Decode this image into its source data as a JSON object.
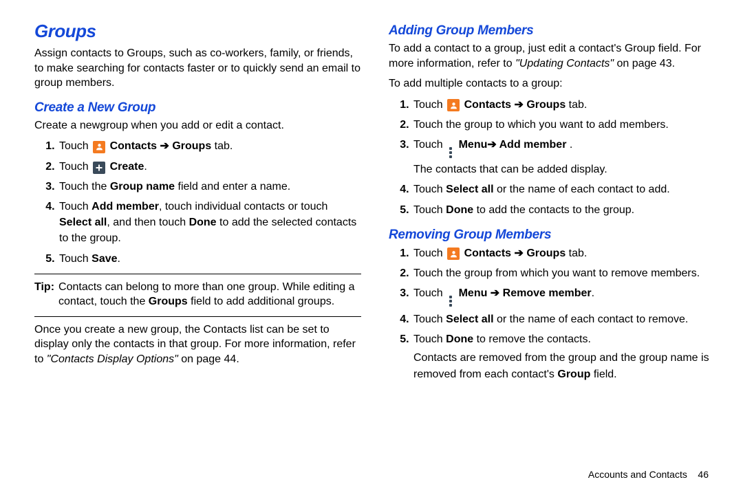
{
  "left": {
    "title": "Groups",
    "intro": "Assign contacts to Groups, such as co-workers, family, or friends, to make searching for contacts faster or to quickly send an email to group members.",
    "create_heading": "Create a New Group",
    "create_intro": "Create a newgroup when you add or edit a contact.",
    "steps": {
      "s1_a": "Touch ",
      "s1_b": " Contacts ➔ Groups",
      "s1_c": " tab.",
      "s2_a": "Touch ",
      "s2_b": " Create",
      "s2_c": ".",
      "s3_a": "Touch the ",
      "s3_b": "Group name",
      "s3_c": " field and enter a name.",
      "s4_a": "Touch ",
      "s4_b": "Add member",
      "s4_c": ", touch individual contacts or touch ",
      "s4_d": "Select all",
      "s4_e": ", and then touch ",
      "s4_f": "Done",
      "s4_g": " to add the selected contacts to the group.",
      "s5_a": "Touch ",
      "s5_b": "Save",
      "s5_c": "."
    },
    "tip_label": "Tip:",
    "tip_body_a": "Contacts can belong to more than one group. While editing a contact, touch the ",
    "tip_body_b": "Groups",
    "tip_body_c": " field to add additional groups.",
    "after_a": "Once you create a new group, the Contacts list can be set to display only the contacts in that group. For more information, refer to ",
    "after_b": "\"Contacts Display Options\"",
    "after_c": " on page 44."
  },
  "right": {
    "add_heading": "Adding Group Members",
    "add_intro_a": "To add a contact to a group, just edit a contact's Group field. For more information, refer to ",
    "add_intro_b": "\"Updating Contacts\"",
    "add_intro_c": " on page 43.",
    "add_multi": "To add multiple contacts to a group:",
    "add_steps": {
      "s1_a": "Touch ",
      "s1_b": " Contacts ➔ Groups",
      "s1_c": " tab.",
      "s2": "Touch the group to which you want to add members.",
      "s3_a": "Touch ",
      "s3_b": " Menu➔ Add member",
      "s3_c": " .",
      "s3_note": "The contacts that can be added display.",
      "s4_a": "Touch ",
      "s4_b": "Select all",
      "s4_c": " or the name of each contact to add.",
      "s5_a": "Touch ",
      "s5_b": "Done",
      "s5_c": " to add the contacts to the group."
    },
    "rem_heading": "Removing Group Members",
    "rem_steps": {
      "s1_a": "Touch ",
      "s1_b": " Contacts ➔ Groups",
      "s1_c": " tab.",
      "s2": "Touch the group from which you want to remove members.",
      "s3_a": "Touch ",
      "s3_b": " Menu ➔ Remove member",
      "s3_c": ".",
      "s4_a": "Touch ",
      "s4_b": "Select all",
      "s4_c": " or the name of each contact to remove.",
      "s5_a": "Touch ",
      "s5_b": "Done",
      "s5_c": " to remove the contacts.",
      "tail_a": "Contacts are removed from the group and the group name is removed from each contact's ",
      "tail_b": "Group",
      "tail_c": " field."
    }
  },
  "footer": {
    "label": "Accounts and Contacts",
    "page": "46"
  }
}
